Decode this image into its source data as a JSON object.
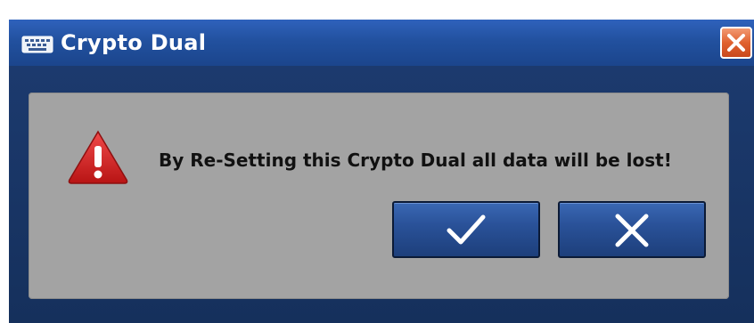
{
  "top_strip_text": "",
  "window": {
    "title": "Crypto Dual",
    "app_icon": "keyboard-icon",
    "close_icon": "close-icon"
  },
  "dialog": {
    "icon": "warning-icon",
    "message": "By Re-Setting this Crypto Dual all data will be lost!",
    "buttons": [
      {
        "icon": "checkmark-icon"
      },
      {
        "icon": "x-icon"
      }
    ]
  },
  "colors": {
    "titlebar": "#2459b0",
    "panel": "#a3a3a3",
    "button": "#2a5299",
    "close": "#e0612f",
    "warning": "#d92424"
  }
}
